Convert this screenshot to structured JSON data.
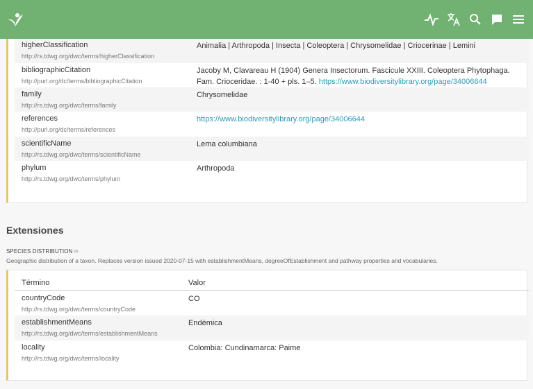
{
  "colors": {
    "topbar": "#71b171",
    "accent_border": "#e9c46a",
    "link": "#2a9bb8"
  },
  "topbar": {
    "logo_icon": "gbif-leaf-logo",
    "icons": [
      "activity-icon",
      "translate-icon",
      "search-icon",
      "feedback-icon",
      "menu-icon"
    ]
  },
  "verbatim": {
    "rows": [
      {
        "term": "higherClassification",
        "uri": "http://rs.tdwg.org/dwc/terms/higherClassification",
        "value": "Animalia | Arthropoda | Insecta | Coleoptera | Chrysomelidae | Criocerinae | Lemini"
      },
      {
        "term": "bibliographicCitation",
        "uri": "http://purl.org/dc/terms/bibliographicCitation",
        "value_line1": "Jacoby M, Clavareau H (1904) Genera Insectorum. Fascicule XXIII. Coleoptera Phytophaga.",
        "value_line2": "Fam. Crioceridae. : 1-40 + pls. 1–5.",
        "value_link": "https://www.biodiversitylibrary.org/page/34006644"
      },
      {
        "term": "family",
        "uri": "http://rs.tdwg.org/dwc/terms/family",
        "value": "Chrysomelidae"
      },
      {
        "term": "references",
        "uri": "http://purl.org/dc/terms/references",
        "value_link": "https://www.biodiversitylibrary.org/page/34006644"
      },
      {
        "term": "scientificName",
        "uri": "http://rs.tdwg.org/dwc/terms/scientificName",
        "value": "Lema columbiana"
      },
      {
        "term": "phylum",
        "uri": "http://rs.tdwg.org/dwc/terms/phylum",
        "value": "Arthropoda"
      }
    ]
  },
  "extensions": {
    "title": "Extensiones",
    "name": "SPECIES DISTRIBUTION",
    "name_icon": "link-icon",
    "description": "Geographic distribution of a taxon. Replaces version issued 2020-07-15 with establishmentMeans, degreeOfEstablishment and pathway properties and vocabularies.",
    "header": {
      "term": "Término",
      "value": "Valor"
    },
    "rows": [
      {
        "term": "countryCode",
        "uri": "http://rs.tdwg.org/dwc/terms/countryCode",
        "value": "CO"
      },
      {
        "term": "establishmentMeans",
        "uri": "http://rs.tdwg.org/dwc/terms/establishmentMeans",
        "value": "Endémica"
      },
      {
        "term": "locality",
        "uri": "http://rs.tdwg.org/dwc/terms/locality",
        "value": "Colombia: Cundinamarca: Paime"
      }
    ]
  }
}
